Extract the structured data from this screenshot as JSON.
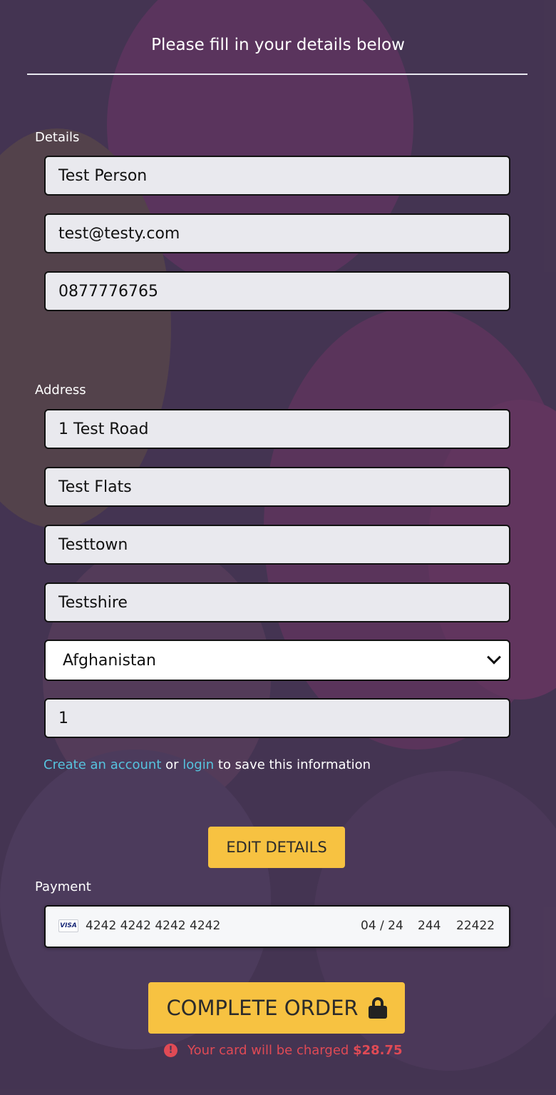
{
  "header": {
    "title": "Please fill in your details below"
  },
  "details": {
    "label": "Details",
    "name": "Test Person",
    "email": "test@testy.com",
    "phone": "0877776765"
  },
  "address": {
    "label": "Address",
    "line1": "1 Test Road",
    "line2": "Test Flats",
    "town": "Testtown",
    "county": "Testshire",
    "country": "Afghanistan",
    "postcode": "1"
  },
  "account": {
    "create_link": "Create an account",
    "or_text": "or",
    "login_link": "login",
    "suffix": "to save this information"
  },
  "edit_button": "EDIT DETAILS",
  "payment": {
    "label": "Payment",
    "card_brand": "VISA",
    "card_number": "4242 4242 4242 4242",
    "expiry": "04 / 24",
    "cvc": "244",
    "zip": "22422"
  },
  "complete_button": "COMPLETE ORDER",
  "charge": {
    "text": "Your card will be charged",
    "amount": "$28.75"
  },
  "colors": {
    "accent_button": "#f7c241",
    "link": "#56c3de",
    "warning": "#e04a55",
    "background": "#4a3a55"
  }
}
